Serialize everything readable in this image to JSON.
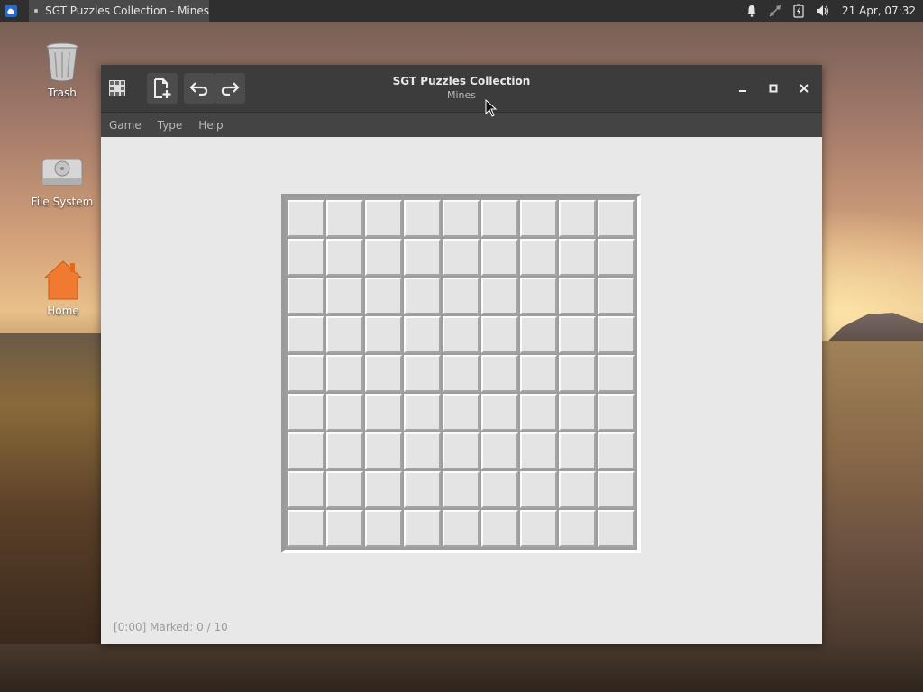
{
  "panel": {
    "task_title": "SGT Puzzles Collection - Mines",
    "clock": "21 Apr, 07:32"
  },
  "desktop": {
    "icons": [
      {
        "label": "Trash",
        "icon": "trash-icon"
      },
      {
        "label": "File System",
        "icon": "drive-icon"
      },
      {
        "label": "Home",
        "icon": "home-icon"
      }
    ]
  },
  "window": {
    "title": "SGT Puzzles Collection",
    "subtitle": "Mines",
    "menu": [
      "Game",
      "Type",
      "Help"
    ],
    "status": "[0:00] Marked: 0 / 10"
  },
  "board": {
    "rows": 9,
    "cols": 9
  },
  "colors": {
    "panel_bg": "#2f2f2f",
    "titlebar_bg": "#3c3c3c",
    "menubar_bg": "#444444",
    "canvas_bg": "#e8e8e8"
  }
}
